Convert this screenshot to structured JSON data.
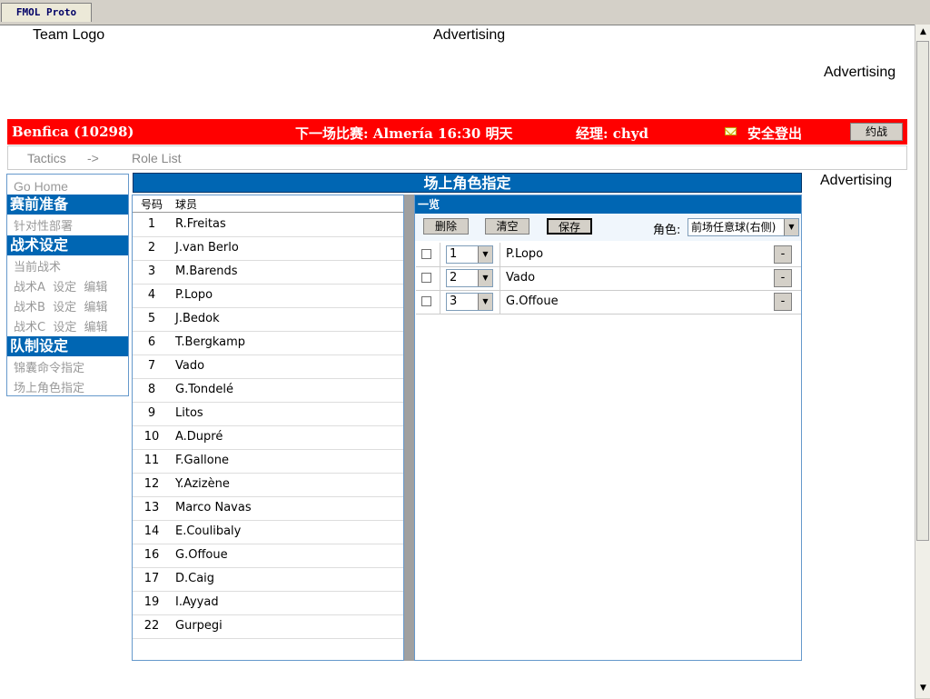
{
  "tab_title": "FMOL Proto",
  "header": {
    "team_logo": "Team Logo",
    "advertising_top": "Advertising",
    "advertising_right": "Advertising"
  },
  "redbar": {
    "team": "Benfica (10298)",
    "next_match": "下一场比赛: Almería 16:30 明天",
    "manager": "经理: chyd",
    "logout": "安全登出",
    "challenge_button": "约战",
    "bg_color": "#ff0000"
  },
  "breadcrumb": {
    "item1": "Tactics",
    "arrow": "->",
    "item2": "Role List"
  },
  "sidebar": {
    "go_home": "Go Home",
    "sections": [
      {
        "title": "赛前准备",
        "items": [
          "针对性部署"
        ]
      },
      {
        "title": "战术设定",
        "items": [
          "当前战术",
          "战术A  设定  编辑",
          "战术B  设定  编辑",
          "战术C  设定  编辑"
        ]
      },
      {
        "title": "队制设定",
        "items": [
          "锦囊命令指定",
          "场上角色指定"
        ]
      }
    ]
  },
  "side_advertising": "Advertising",
  "main_title": "场上角色指定",
  "player_list": {
    "col_number": "号码",
    "col_player": "球员",
    "rows": [
      {
        "num": "1",
        "name": "R.Freitas"
      },
      {
        "num": "2",
        "name": "J.van Berlo"
      },
      {
        "num": "3",
        "name": "M.Barends"
      },
      {
        "num": "4",
        "name": "P.Lopo"
      },
      {
        "num": "5",
        "name": "J.Bedok"
      },
      {
        "num": "6",
        "name": "T.Bergkamp"
      },
      {
        "num": "7",
        "name": "Vado"
      },
      {
        "num": "8",
        "name": "G.Tondelé"
      },
      {
        "num": "9",
        "name": "Litos"
      },
      {
        "num": "10",
        "name": "A.Dupré"
      },
      {
        "num": "11",
        "name": "F.Gallone"
      },
      {
        "num": "12",
        "name": "Y.Azizène"
      },
      {
        "num": "13",
        "name": "Marco Navas"
      },
      {
        "num": "14",
        "name": "E.Coulibaly"
      },
      {
        "num": "16",
        "name": "G.Offoue"
      },
      {
        "num": "17",
        "name": "D.Caig"
      },
      {
        "num": "19",
        "name": "I.Ayyad"
      },
      {
        "num": "22",
        "name": "Gurpegi"
      }
    ]
  },
  "overview": {
    "title": "一览",
    "delete_button": "删除",
    "clear_button": "清空",
    "save_button": "保存",
    "role_label": "角色:",
    "role_value": "前场任意球(右侧)",
    "assignments": [
      {
        "order": "1",
        "name": "P.Lopo",
        "remove": "-"
      },
      {
        "order": "2",
        "name": "Vado",
        "remove": "-"
      },
      {
        "order": "3",
        "name": "G.Offoue",
        "remove": "-"
      }
    ]
  }
}
